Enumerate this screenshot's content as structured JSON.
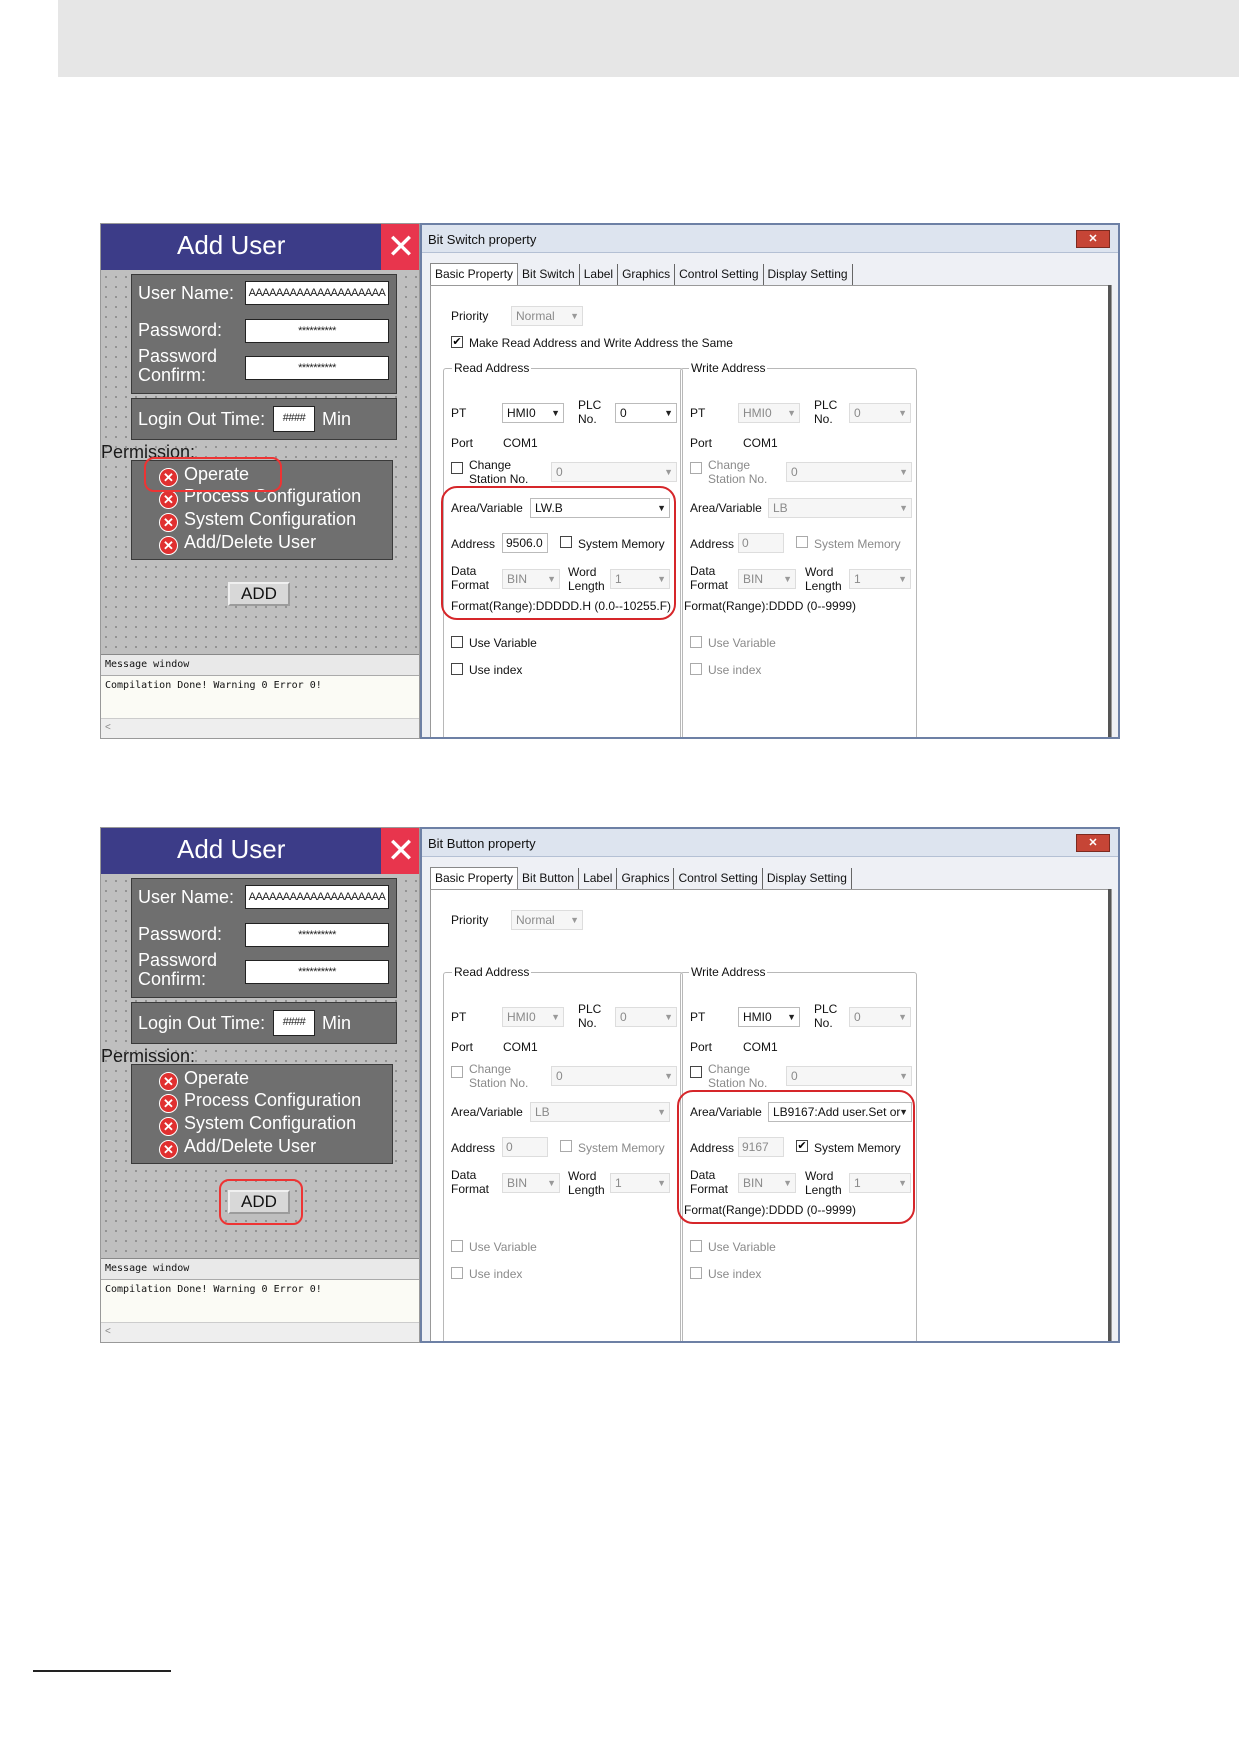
{
  "panel_common": {
    "title": "Add User",
    "close_glyph": "✕",
    "username_label": "User Name:",
    "username_value": "AAAAAAAAAAAAAAAAAAAA",
    "password_label": "Password:",
    "password_value": "**********",
    "password_confirm_label": "Password\nConfirm:",
    "password_confirm_value": "**********",
    "logout_label": "Login Out Time:",
    "logout_value": "####",
    "logout_unit": "Min",
    "permission_label": "Permission:",
    "permissions": [
      "Operate",
      "Process Configuration",
      "System Configuration",
      "Add/Delete User"
    ],
    "add_label": "ADD",
    "message_title": "Message window",
    "message_text": "Compilation Done! Warning 0 Error 0!",
    "scroll_glyph": "<"
  },
  "dialog1": {
    "title": "Bit Switch property",
    "close_glyph": "✕",
    "tabs": [
      "Basic Property",
      "Bit Switch",
      "Label",
      "Graphics",
      "Control Setting",
      "Display Setting"
    ],
    "priority_label": "Priority",
    "priority_value": "Normal",
    "same_address_label": "Make Read Address and Write Address the Same",
    "read": {
      "title": "Read Address",
      "pt_label": "PT",
      "pt_value": "HMI0",
      "plc_label": "PLC\nNo.",
      "plc_value": "0",
      "port_label": "Port",
      "port_value": "COM1",
      "change_label": "Change\nStation No.",
      "change_value": "0",
      "area_label": "Area/Variable",
      "area_value": "LW.B",
      "address_label": "Address",
      "address_value": "9506.0",
      "sysmem_label": "System Memory",
      "dataformat_label": "Data\nFormat",
      "dataformat_value": "BIN",
      "wordlen_label": "Word\nLength",
      "wordlen_value": "1",
      "format_range": "Format(Range):DDDDD.H (0.0--10255.F)",
      "use_variable": "Use Variable",
      "use_index": "Use index"
    },
    "write": {
      "title": "Write Address",
      "pt_label": "PT",
      "pt_value": "HMI0",
      "plc_label": "PLC\nNo.",
      "plc_value": "0",
      "port_label": "Port",
      "port_value": "COM1",
      "change_label": "Change\nStation No.",
      "change_value": "0",
      "area_label": "Area/Variable",
      "area_value": "LB",
      "address_label": "Address",
      "address_value": "0",
      "sysmem_label": "System Memory",
      "dataformat_label": "Data\nFormat",
      "dataformat_value": "BIN",
      "wordlen_label": "Word\nLength",
      "wordlen_value": "1",
      "format_range": "Format(Range):DDDD (0--9999)",
      "use_variable": "Use Variable",
      "use_index": "Use index"
    }
  },
  "dialog2": {
    "title": "Bit Button property",
    "close_glyph": "✕",
    "tabs": [
      "Basic Property",
      "Bit Button",
      "Label",
      "Graphics",
      "Control Setting",
      "Display Setting"
    ],
    "priority_label": "Priority",
    "priority_value": "Normal",
    "read": {
      "title": "Read Address",
      "pt_label": "PT",
      "pt_value": "HMI0",
      "plc_label": "PLC\nNo.",
      "plc_value": "0",
      "port_label": "Port",
      "port_value": "COM1",
      "change_label": "Change\nStation No.",
      "change_value": "0",
      "area_label": "Area/Variable",
      "area_value": "LB",
      "address_label": "Address",
      "address_value": "0",
      "sysmem_label": "System Memory",
      "dataformat_label": "Data\nFormat",
      "dataformat_value": "BIN",
      "wordlen_label": "Word\nLength",
      "wordlen_value": "1",
      "use_variable": "Use Variable",
      "use_index": "Use index"
    },
    "write": {
      "title": "Write Address",
      "pt_label": "PT",
      "pt_value": "HMI0",
      "plc_label": "PLC\nNo.",
      "plc_value": "0",
      "port_label": "Port",
      "port_value": "COM1",
      "change_label": "Change\nStation No.",
      "change_value": "0",
      "area_label": "Area/Variable",
      "area_value": "LB9167:Add user.Set or",
      "address_label": "Address",
      "address_value": "9167",
      "sysmem_label": "System Memory",
      "dataformat_label": "Data\nFormat",
      "dataformat_value": "BIN",
      "wordlen_label": "Word\nLength",
      "wordlen_value": "1",
      "format_range": "Format(Range):DDDD (0--9999)",
      "use_variable": "Use Variable",
      "use_index": "Use index"
    }
  },
  "colors": {
    "panel_header": "#3c3c88",
    "close_red": "#e8354d",
    "highlight_red": "#d6262a",
    "group_gray": "#6f6f6f"
  }
}
